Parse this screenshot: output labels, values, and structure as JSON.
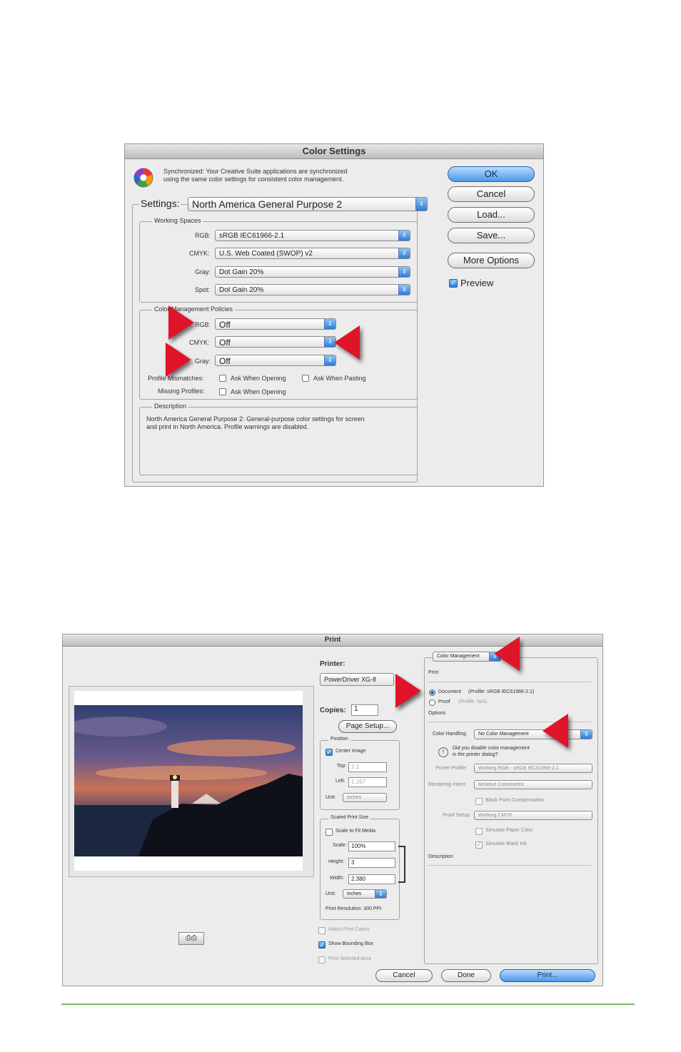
{
  "color_settings": {
    "title": "Color Settings",
    "sync_text_line1": "Synchronized: Your Creative Suite applications are synchronized",
    "sync_text_line2": "using the same color settings for consistent color management.",
    "settings_label": "Settings:",
    "settings_value": "North America General Purpose 2",
    "working_spaces": {
      "label": "Working Spaces",
      "rgb_label": "RGB:",
      "rgb_value": "sRGB IEC61966-2.1",
      "cmyk_label": "CMYK:",
      "cmyk_value": "U.S. Web Coated (SWOP) v2",
      "gray_label": "Gray:",
      "gray_value": "Dot Gain 20%",
      "spot_label": "Spot:",
      "spot_value": "Dot Gain 20%"
    },
    "policies": {
      "label": "Color Management Policies",
      "rgb_label": "RGB:",
      "rgb_value": "Off",
      "cmyk_label": "CMYK:",
      "cmyk_value": "Off",
      "gray_label": "Gray:",
      "gray_value": "Off",
      "mismatch_label": "Profile Mismatches:",
      "ask_opening": "Ask When Opening",
      "ask_pasting": "Ask When Pasting",
      "missing_label": "Missing Profiles:",
      "ask_opening_missing": "Ask When Opening"
    },
    "description": {
      "label": "Description",
      "line1": "North America General Purpose 2:  General-purpose color settings for screen",
      "line2": "and print in North America. Profile warnings are disabled."
    },
    "buttons": {
      "ok": "OK",
      "cancel": "Cancel",
      "load": "Load...",
      "save": "Save...",
      "more": "More Options"
    },
    "preview_label": "Preview"
  },
  "print": {
    "title": "Print",
    "printer_label": "Printer:",
    "printer_value": "PowerDriver XG-8",
    "copies_label": "Copies:",
    "copies_value": "1",
    "page_setup": "Page Setup...",
    "position": {
      "label": "Position",
      "center_image": "Center Image",
      "top_label": "Top:",
      "top_value": "2.1",
      "left_label": "Left:",
      "left_value": "1.167",
      "unit_label": "Unit:",
      "unit_value": "inches"
    },
    "scaled": {
      "label": "Scaled Print Size",
      "scale_to_fit": "Scale to Fit Media",
      "scale_label": "Scale:",
      "scale_value": "100%",
      "height_label": "Height:",
      "height_value": "3",
      "width_label": "Width:",
      "width_value": "2.380",
      "unit_label": "Unit:",
      "unit_value": "inches",
      "resolution": "Print Resolution: 300 PPI"
    },
    "match_colors": "Match Print Colors",
    "show_bbox": "Show Bounding Box",
    "print_selected": "Print Selected Area",
    "right_panel": {
      "menu_value": "Color Management",
      "print_label": "Print",
      "document_label": "Document",
      "document_profile": "(Profile: sRGB IEC61966-2.1)",
      "proof_label": "Proof",
      "proof_profile": "(Profile: N/A)",
      "options_label": "Options",
      "color_handling_label": "Color Handling:",
      "color_handling_value": "No Color Management",
      "warning_line1": "Did you disable color management",
      "warning_line2": "in the printer dialog?",
      "printer_profile_label": "Printer Profile:",
      "printer_profile_value": "Working RGB - sRGB IEC61966-2.1",
      "rendering_label": "Rendering Intent:",
      "rendering_value": "Relative Colorimetric",
      "bpc_label": "Black Point Compensation",
      "proof_setup_label": "Proof Setup:",
      "proof_setup_value": "Working CMYK",
      "sim_paper": "Simulate Paper Color",
      "sim_black": "Simulate Black Ink",
      "description_label": "Description"
    },
    "buttons": {
      "cancel": "Cancel",
      "done": "Done",
      "print": "Print..."
    }
  }
}
